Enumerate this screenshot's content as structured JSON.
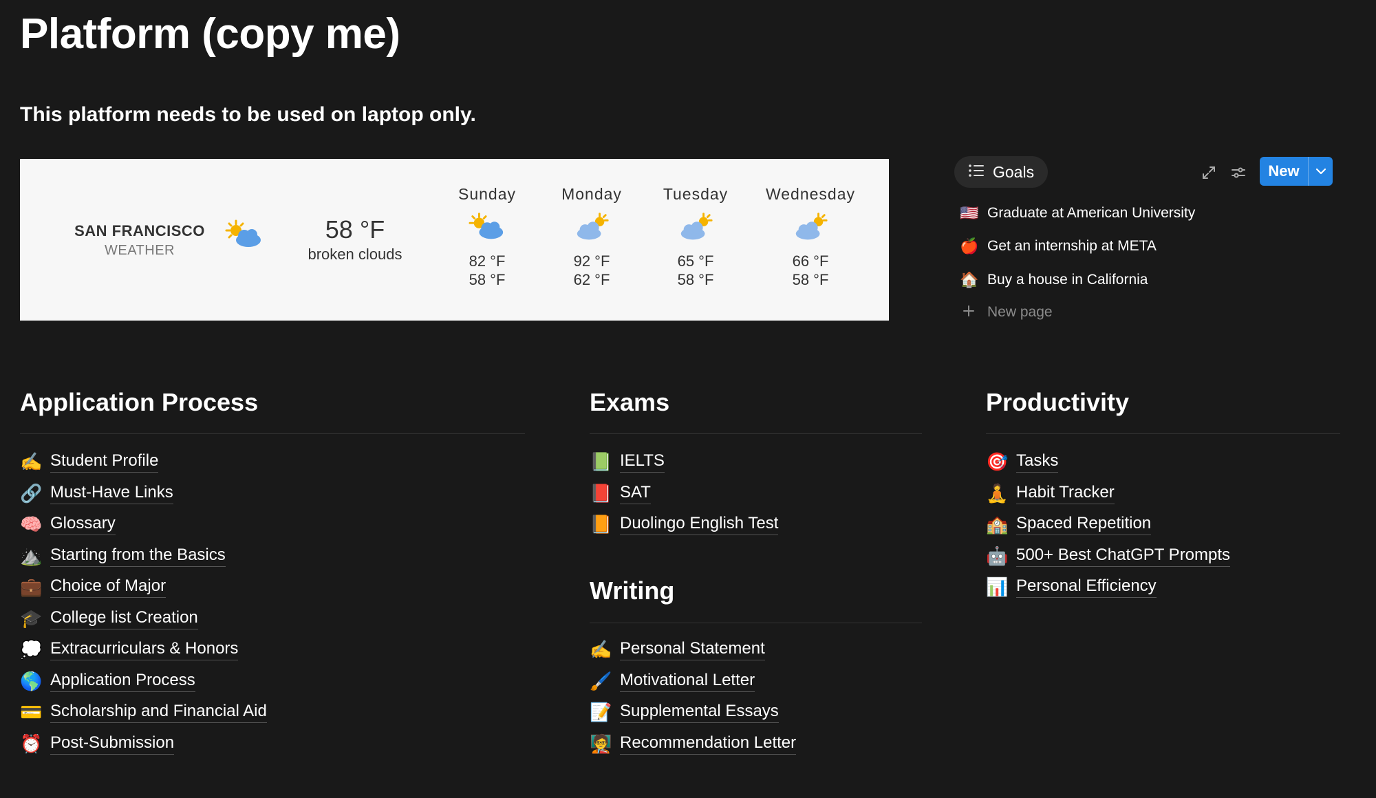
{
  "page": {
    "title": "Platform (copy me)",
    "subtitle": "This platform needs to be used on laptop only."
  },
  "weather": {
    "city": "SAN FRANCISCO",
    "label": "WEATHER",
    "current_temp": "58 °F",
    "condition": "broken clouds",
    "days": [
      {
        "name": "Sunday",
        "hi": "82 °F",
        "lo": "58 °F"
      },
      {
        "name": "Monday",
        "hi": "92 °F",
        "lo": "62 °F"
      },
      {
        "name": "Tuesday",
        "hi": "65 °F",
        "lo": "58 °F"
      },
      {
        "name": "Wednesday",
        "hi": "66 °F",
        "lo": "58 °F"
      }
    ]
  },
  "goals": {
    "tab_label": "Goals",
    "new_label": "New",
    "items": [
      {
        "emoji": "🇺🇸",
        "label": "Graduate at American University"
      },
      {
        "emoji": "🍎",
        "label": "Get an internship at META"
      },
      {
        "emoji": "🏠",
        "label": "Buy a house in California"
      }
    ],
    "new_page_label": "New page"
  },
  "sections": {
    "application": {
      "title": "Application Process",
      "items": [
        {
          "emoji": "✍️",
          "label": "Student Profile"
        },
        {
          "emoji": "🔗",
          "label": "Must-Have Links"
        },
        {
          "emoji": "🧠",
          "label": "Glossary"
        },
        {
          "emoji": "⛰️",
          "label": "Starting from the Basics"
        },
        {
          "emoji": "💼",
          "label": "Choice of Major"
        },
        {
          "emoji": "🎓",
          "label": "College list Creation"
        },
        {
          "emoji": "💭",
          "label": "Extracurriculars & Honors"
        },
        {
          "emoji": "🌎",
          "label": "Application Process"
        },
        {
          "emoji": "💳",
          "label": "Scholarship and Financial Aid"
        },
        {
          "emoji": "⏰",
          "label": "Post-Submission"
        }
      ]
    },
    "exams": {
      "title": "Exams",
      "items": [
        {
          "emoji": "📗",
          "label": "IELTS"
        },
        {
          "emoji": "📕",
          "label": "SAT"
        },
        {
          "emoji": "📙",
          "label": "Duolingo English Test"
        }
      ]
    },
    "writing": {
      "title": "Writing",
      "items": [
        {
          "emoji": "✍️",
          "label": "Personal Statement"
        },
        {
          "emoji": "🖌️",
          "label": "Motivational Letter"
        },
        {
          "emoji": "📝",
          "label": "Supplemental Essays"
        },
        {
          "emoji": "🧑‍🏫",
          "label": "Recommendation Letter"
        }
      ]
    },
    "productivity": {
      "title": "Productivity",
      "items": [
        {
          "emoji": "🎯",
          "label": "Tasks"
        },
        {
          "emoji": "🧘",
          "label": "Habit Tracker"
        },
        {
          "emoji": "🏫",
          "label": "Spaced Repetition"
        },
        {
          "emoji": "🤖",
          "label": "500+ Best ChatGPT Prompts"
        },
        {
          "emoji": "📊",
          "label": "Personal Efficiency"
        }
      ]
    }
  },
  "colors": {
    "background": "#191919",
    "accent": "#2383e2",
    "widget_bg": "#f7f7f7"
  }
}
